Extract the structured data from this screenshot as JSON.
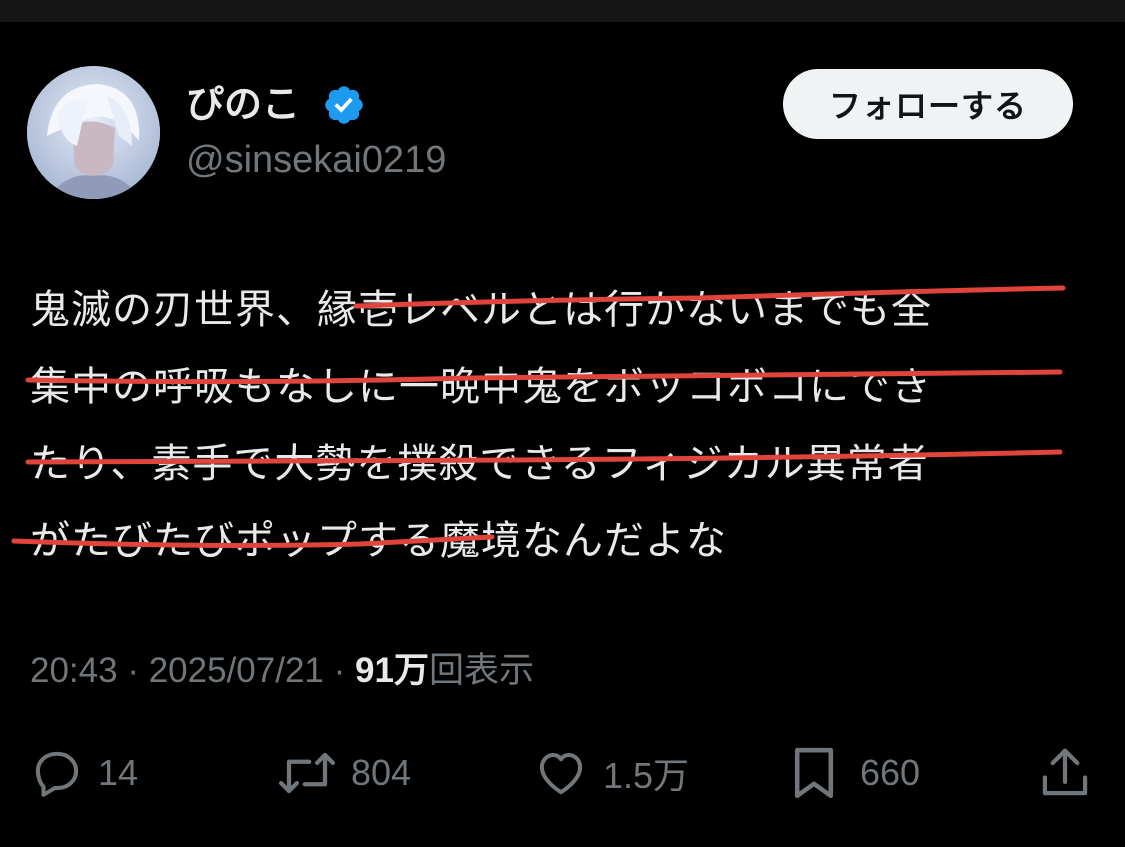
{
  "user": {
    "display_name": "ぴのこ",
    "handle": "@sinsekai0219",
    "verified_icon": "verified-badge-icon"
  },
  "follow_button": {
    "label": "フォローする"
  },
  "tweet": {
    "lines": [
      "鬼滅の刃世界、縁壱レベルとは行かないまでも全",
      "集中の呼吸もなしに一晩中鬼をボッコボコにでき",
      "たり、素手で大勢を撲殺できるフィジカル異常者",
      "がたびたびポップする魔境なんだよな"
    ],
    "strikethrough_color": "#e0443a"
  },
  "meta": {
    "time": "20:43",
    "date": "2025/07/21",
    "views_value": "91万",
    "views_label": "回表示",
    "separator": "·"
  },
  "actions": {
    "reply": {
      "icon": "reply-icon",
      "count": "14"
    },
    "repost": {
      "icon": "repost-icon",
      "count": "804"
    },
    "like": {
      "icon": "heart-icon",
      "count": "1.5万"
    },
    "bookmark": {
      "icon": "bookmark-icon",
      "count": "660"
    },
    "share": {
      "icon": "share-icon"
    }
  }
}
